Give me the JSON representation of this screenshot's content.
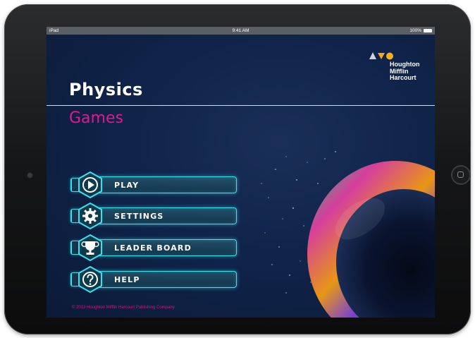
{
  "status_bar": {
    "device": "iPad",
    "time": "9:41 AM",
    "battery": "100%"
  },
  "logo": {
    "lines": [
      "Houghton",
      "Mifflin",
      "Harcourt"
    ]
  },
  "header": {
    "title": "Physics",
    "subtitle": "Games"
  },
  "menu": {
    "play": "PLAY",
    "settings": "SETTINGS",
    "leaderboard": "LEADER BOARD",
    "help": "HELP"
  },
  "footer": {
    "copyright": "© 2013 Houghton Mifflin Harcourt Publishing Company"
  },
  "colors": {
    "background": "#0e2146",
    "accent_cyan": "#38e3f0",
    "subtitle_pink": "#e3188c"
  },
  "icons": {
    "play": "play-icon",
    "settings": "gear-icon",
    "leaderboard": "trophy-icon",
    "help": "question-icon"
  }
}
